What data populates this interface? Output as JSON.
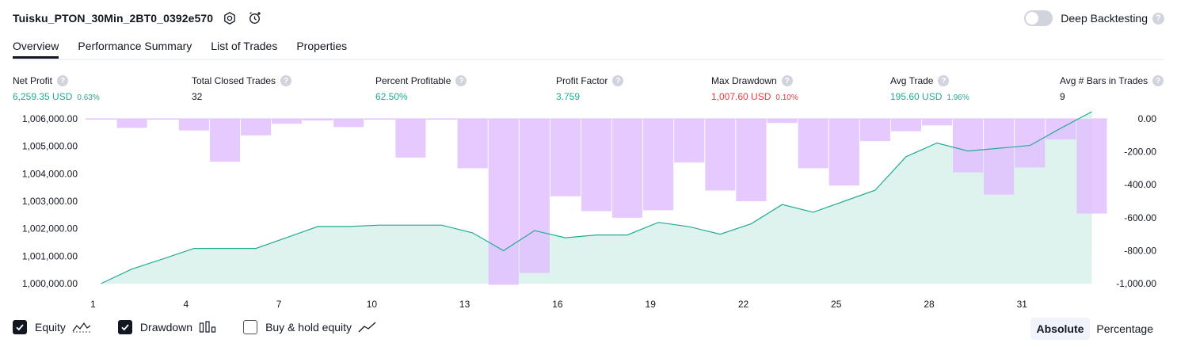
{
  "header": {
    "title": "Tuisku_PTON_30Min_2BT0_0392e570",
    "deep_backtesting_label": "Deep Backtesting",
    "help": "?"
  },
  "tabs": [
    {
      "label": "Overview",
      "active": true
    },
    {
      "label": "Performance Summary",
      "active": false
    },
    {
      "label": "List of Trades",
      "active": false
    },
    {
      "label": "Properties",
      "active": false
    }
  ],
  "metrics": {
    "net_profit": {
      "label": "Net Profit",
      "value": "6,259.35 USD",
      "pct": "0.63%"
    },
    "total_closed_trades": {
      "label": "Total Closed Trades",
      "value": "32"
    },
    "percent_profitable": {
      "label": "Percent Profitable",
      "value": "62.50%"
    },
    "profit_factor": {
      "label": "Profit Factor",
      "value": "3.759"
    },
    "max_drawdown": {
      "label": "Max Drawdown",
      "value": "1,007.60 USD",
      "pct": "0.10%"
    },
    "avg_trade": {
      "label": "Avg Trade",
      "value": "195.60 USD",
      "pct": "1.96%"
    },
    "avg_bars": {
      "label": "Avg # Bars in Trades",
      "value": "9"
    }
  },
  "colors": {
    "equity_line": "#22ab94",
    "equity_fill": "#dff3ee",
    "drawdown": "#e1bfff",
    "positive": "#22ab94",
    "negative": "#f23645"
  },
  "chart_data": {
    "type": "area",
    "x": [
      1,
      2,
      3,
      4,
      5,
      6,
      7,
      8,
      9,
      10,
      11,
      12,
      13,
      14,
      15,
      16,
      17,
      18,
      19,
      20,
      21,
      22,
      23,
      24,
      25,
      26,
      27,
      28,
      29,
      30,
      31,
      32,
      33
    ],
    "x_tick_labels": [
      "1",
      "4",
      "7",
      "10",
      "13",
      "16",
      "19",
      "22",
      "25",
      "28",
      "31"
    ],
    "left_axis_ticks": [
      "1,000,000.00",
      "1,001,000.00",
      "1,002,000.00",
      "1,003,000.00",
      "1,004,000.00",
      "1,005,000.00",
      "1,006,000.00"
    ],
    "right_axis_ticks": [
      "0.00",
      "-200.00",
      "-400.00",
      "-600.00",
      "-800.00",
      "-1,000.00"
    ],
    "left_ylim": [
      1000000,
      1006000
    ],
    "right_ylim": [
      -1000,
      0
    ],
    "series": [
      {
        "name": "Equity",
        "axis": "left",
        "values": [
          1000000,
          1000530,
          1000900,
          1001280,
          1001280,
          1001280,
          1001680,
          1002080,
          1002080,
          1002130,
          1002130,
          1002130,
          1001850,
          1001200,
          1001930,
          1001670,
          1001770,
          1001770,
          1002230,
          1002070,
          1001800,
          1002180,
          1002880,
          1002600,
          1003000,
          1003400,
          1004620,
          1005120,
          1004830,
          1004930,
          1005030,
          1005660,
          1006260
        ]
      },
      {
        "name": "Drawdown",
        "axis": "right",
        "type": "bar",
        "values": [
          -5,
          -55,
          -5,
          -70,
          -260,
          -100,
          -30,
          -10,
          -50,
          -5,
          -235,
          -5,
          -300,
          -1007,
          -935,
          -470,
          -560,
          -600,
          -555,
          -265,
          -435,
          -500,
          -25,
          -300,
          -405,
          -135,
          -75,
          -40,
          -325,
          -460,
          -295,
          -125,
          -575
        ]
      }
    ]
  },
  "legend": {
    "equity": {
      "label": "Equity",
      "checked": true
    },
    "drawdown": {
      "label": "Drawdown",
      "checked": true
    },
    "buy_hold": {
      "label": "Buy & hold equity",
      "checked": false
    }
  },
  "modes": {
    "absolute": "Absolute",
    "percentage": "Percentage",
    "active": "Absolute"
  }
}
